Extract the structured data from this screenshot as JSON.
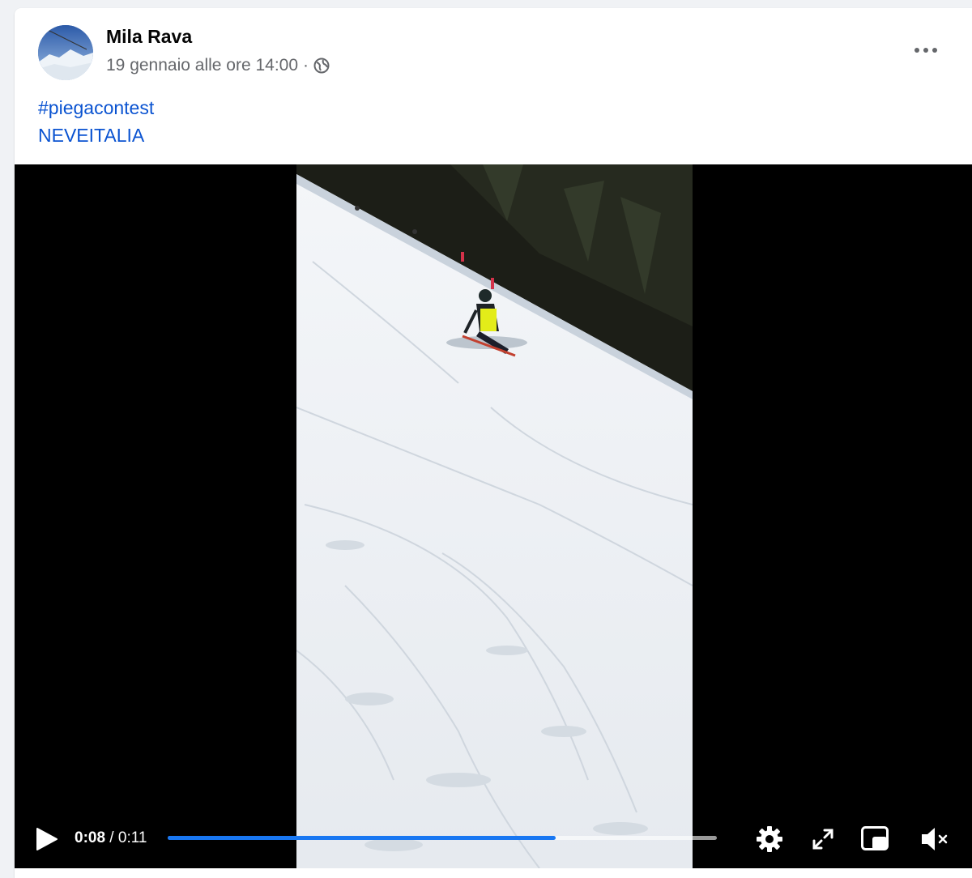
{
  "post": {
    "author_name": "Mila Rava",
    "timestamp": "19 gennaio alle ore 14:00",
    "separator": "·",
    "privacy_icon": "globe-icon",
    "more_icon": "more-options-icon",
    "text_lines": [
      "#piegacontest",
      "NEVEITALIA"
    ]
  },
  "video": {
    "current_time": "0:08",
    "time_separator": " / ",
    "duration": "0:11",
    "progress": 0.706,
    "controls": [
      "play-icon",
      "settings-icon",
      "fullscreen-icon",
      "picture-in-picture-icon",
      "muted-volume-icon"
    ]
  },
  "colors": {
    "link": "#0a53d1",
    "progress_fill": "#1877f2",
    "player_bg": "#000000"
  }
}
